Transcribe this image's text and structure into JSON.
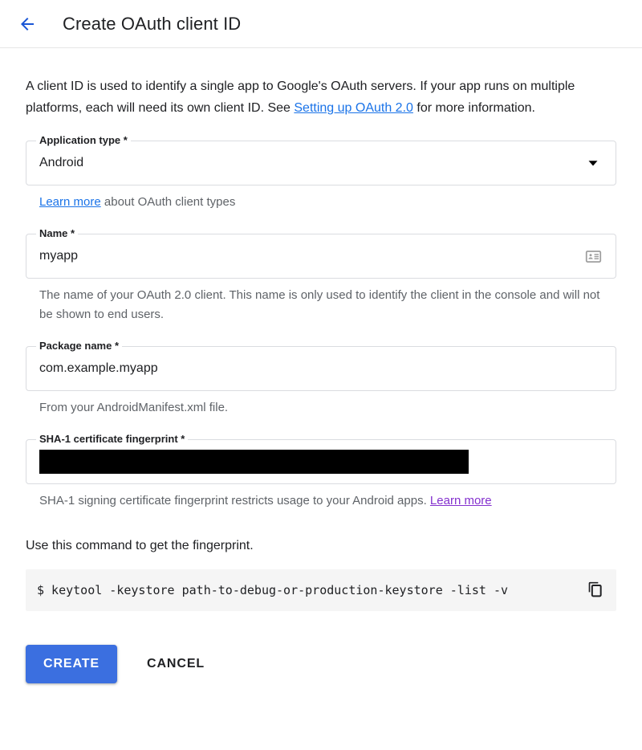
{
  "header": {
    "back_icon": "arrow-left-icon",
    "title": "Create OAuth client ID"
  },
  "intro": {
    "part1": "A client ID is used to identify a single app to Google's OAuth servers. If your app runs on multiple platforms, each will need its own client ID. See ",
    "link_text": "Setting up OAuth 2.0",
    "part2": " for more information."
  },
  "fields": {
    "application_type": {
      "label": "Application type *",
      "value": "Android",
      "dropdown_icon": "chevron-down-icon",
      "helper_link": "Learn more",
      "helper_rest": " about OAuth client types"
    },
    "name": {
      "label": "Name *",
      "value": "myapp",
      "placeholder": "Name",
      "trailing_icon": "contact-card-icon",
      "helper": "The name of your OAuth 2.0 client. This name is only used to identify the client in the console and will not be shown to end users."
    },
    "package_name": {
      "label": "Package name *",
      "value": "com.example.myapp",
      "placeholder": "Package name",
      "helper": "From your AndroidManifest.xml file."
    },
    "sha1": {
      "label": "SHA-1 certificate fingerprint *",
      "value": "",
      "placeholder": "SHA-1 certificate fingerprint",
      "redacted": true,
      "helper_text": "SHA-1 signing certificate fingerprint restricts usage to your Android apps. ",
      "helper_link": "Learn more"
    }
  },
  "command": {
    "intro": "Use this command to get the fingerprint.",
    "text": "$ keytool -keystore path-to-debug-or-production-keystore -list -v",
    "copy_icon": "copy-icon"
  },
  "actions": {
    "create_label": "CREATE",
    "cancel_label": "CANCEL"
  },
  "colors": {
    "accent_blue": "#1a73e8",
    "button_blue": "#3b6fe0",
    "visited_purple": "#8430ce",
    "helper_gray": "#5f6368",
    "border_gray": "#dadce0",
    "code_bg": "#f5f5f5",
    "redaction_black": "#000000"
  }
}
